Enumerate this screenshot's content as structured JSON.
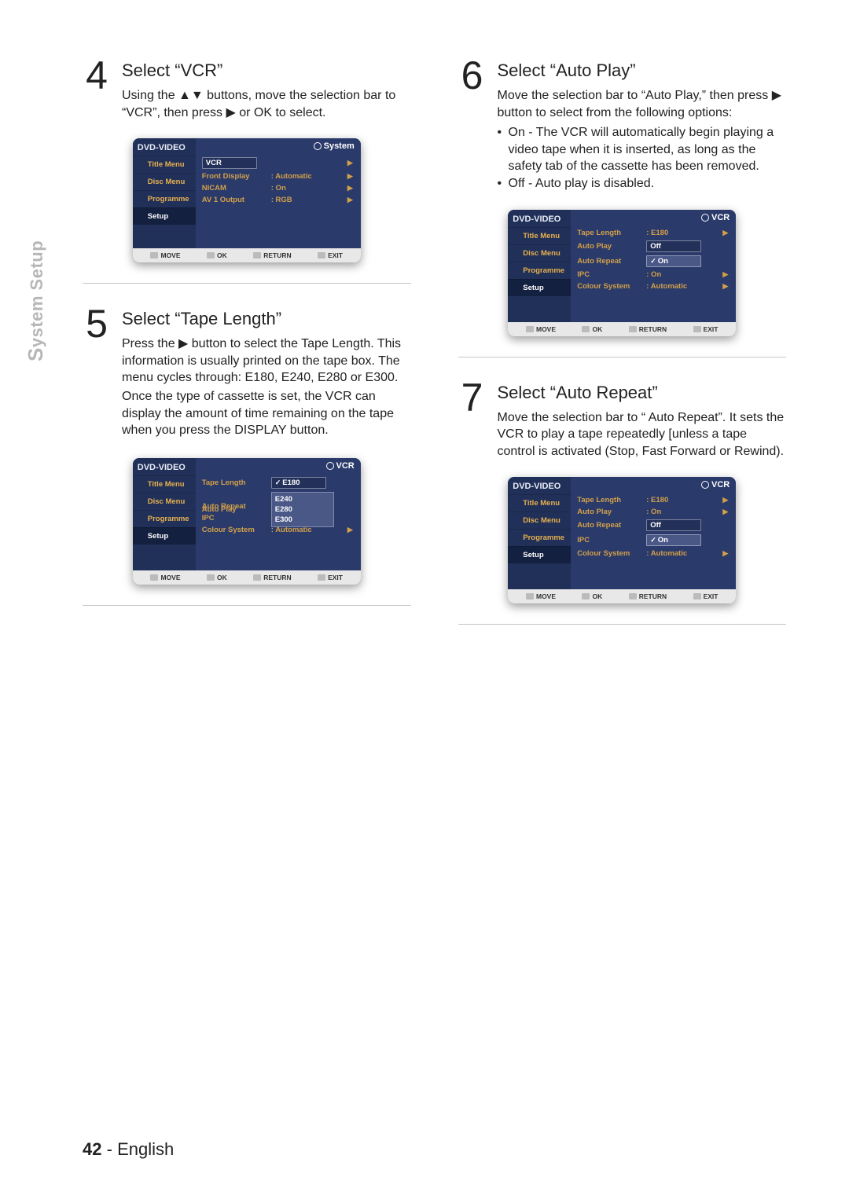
{
  "side_tab": "System Setup",
  "page_number": "42",
  "page_lang": "English",
  "osd_common": {
    "header": "DVD-VIDEO",
    "sidebar": [
      "Title Menu",
      "Disc Menu",
      "Programme",
      "Setup"
    ],
    "foot": {
      "move": "MOVE",
      "ok": "OK",
      "return": "RETURN",
      "exit": "EXIT"
    }
  },
  "steps": {
    "s4": {
      "num": "4",
      "title": "Select “VCR”",
      "desc": "Using the ▲▼ buttons, move the selection bar to “VCR”, then press ▶ or OK to select.",
      "tag": "System",
      "rows": {
        "vcr": "VCR",
        "fd_lbl": "Front Display",
        "fd_val": ": Automatic",
        "ni_lbl": "NICAM",
        "ni_val": ": On",
        "av_lbl": "AV 1 Output",
        "av_val": ": RGB"
      }
    },
    "s5": {
      "num": "5",
      "title": "Select “Tape Length”",
      "desc1": "Press the ▶ button to select the Tape Length. This information is usually printed on the tape box. The menu cycles through: E180, E240, E280 or E300.",
      "desc2": "Once the type of cassette is set, the VCR can display the amount of time remaining on the tape when you press the DISPLAY button.",
      "tag": "VCR",
      "rows": {
        "tl_lbl": "Tape Length",
        "tl_val": "E180",
        "ap_lbl": "Auto Play",
        "ar_lbl": "Auto Repeat",
        "ipc_lbl": "IPC",
        "cs_lbl": "Colour System",
        "cs_val": ": Automatic",
        "dd": {
          "o1": "E240",
          "o2": "E280",
          "o3": "E300"
        }
      }
    },
    "s6": {
      "num": "6",
      "title": "Select “Auto Play”",
      "desc": "Move the selection bar to “Auto Play,” then press ▶ button to select from the following options:",
      "b_on": "On - The VCR will automatically begin playing a video tape when it is inserted, as long as the safety tab of the cassette has been removed.",
      "b_off": "Off - Auto play is disabled.",
      "tag": "VCR",
      "rows": {
        "tl_lbl": "Tape Length",
        "tl_val": ": E180",
        "ap_lbl": "Auto Play",
        "ap_off": "Off",
        "ap_on": "On",
        "ar_lbl": "Auto Repeat",
        "ipc_lbl": "IPC",
        "ipc_val": ": On",
        "cs_lbl": "Colour System",
        "cs_val": ": Automatic"
      }
    },
    "s7": {
      "num": "7",
      "title": "Select “Auto Repeat”",
      "desc": "Move the selection bar to “ Auto Repeat”. It sets the VCR to play a tape repeatedly [unless a tape control is activated (Stop, Fast Forward or Rewind).",
      "tag": "VCR",
      "rows": {
        "tl_lbl": "Tape Length",
        "tl_val": ": E180",
        "ap_lbl": "Auto Play",
        "ap_val": ": On",
        "ar_lbl": "Auto Repeat",
        "ar_off": "Off",
        "ar_on": "On",
        "ipc_lbl": "IPC",
        "cs_lbl": "Colour System",
        "cs_val": ": Automatic"
      }
    }
  }
}
